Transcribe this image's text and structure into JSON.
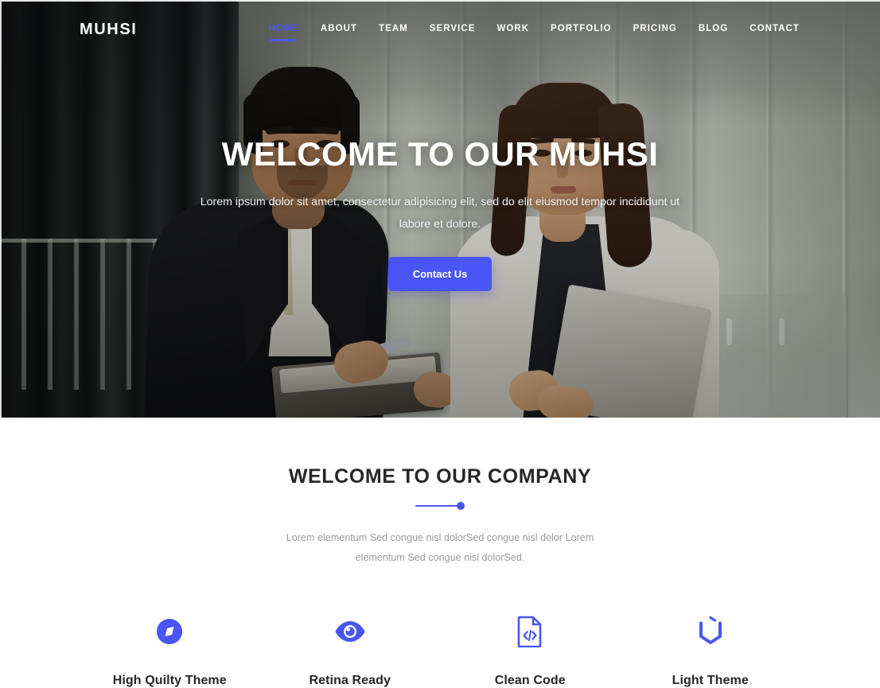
{
  "brand": {
    "logo_text": "MUHSI"
  },
  "nav": {
    "items": [
      {
        "label": "HOME",
        "active": true
      },
      {
        "label": "ABOUT",
        "active": false
      },
      {
        "label": "TEAM",
        "active": false
      },
      {
        "label": "SERVICE",
        "active": false
      },
      {
        "label": "WORK",
        "active": false
      },
      {
        "label": "PORTFOLIO",
        "active": false
      },
      {
        "label": "PRICING",
        "active": false
      },
      {
        "label": "BLOG",
        "active": false
      },
      {
        "label": "CONTACT",
        "active": false
      }
    ]
  },
  "hero": {
    "title": "WELCOME TO OUR MUHSI",
    "subtitle": "Lorem ipsum dolor sit amet, consectetur adipisicing elit, sed do elit eiusmod tempor incididunt ut labore et dolore.",
    "cta_label": "Contact Us"
  },
  "welcome": {
    "heading": "WELCOME TO OUR COMPANY",
    "paragraph": "Lorem elementum Sed congue nisl dolorSed congue nisl dolor Lorem elementum Sed congue nisl dolorSed."
  },
  "features": [
    {
      "title": "High Quilty Theme",
      "icon": "compass-icon"
    },
    {
      "title": "Retina Ready",
      "icon": "eye-icon"
    },
    {
      "title": "Clean Code",
      "icon": "code-file-icon"
    },
    {
      "title": "Light Theme",
      "icon": "hexagon-bulb-icon"
    }
  ],
  "colors": {
    "accent": "#4a55f5",
    "heading": "#27272b",
    "body_text": "#9a9a9e",
    "hero_text": "#ffffff"
  }
}
